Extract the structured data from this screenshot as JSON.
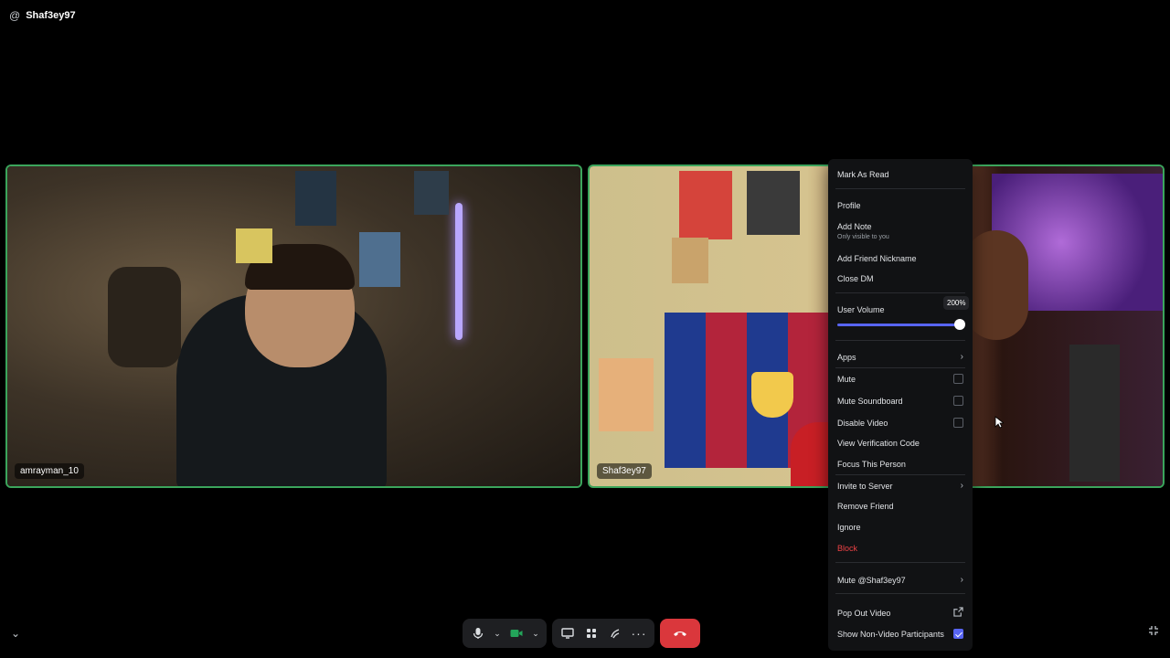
{
  "header": {
    "username": "Shaf3ey97",
    "icon": "at-icon"
  },
  "tiles": [
    {
      "name": "amrayman_10"
    },
    {
      "name": "Shaf3ey97"
    }
  ],
  "menu": {
    "mark_as_read": "Mark As Read",
    "profile": "Profile",
    "add_note": "Add Note",
    "add_note_sub": "Only visible to you",
    "add_friend_nickname": "Add Friend Nickname",
    "close_dm": "Close DM",
    "user_volume": "User Volume",
    "volume_value": "200%",
    "apps": "Apps",
    "mute": "Mute",
    "mute_soundboard": "Mute Soundboard",
    "disable_video": "Disable Video",
    "view_verification_code": "View Verification Code",
    "focus_this_person": "Focus This Person",
    "invite_to_server": "Invite to Server",
    "remove_friend": "Remove Friend",
    "ignore": "Ignore",
    "block": "Block",
    "mute_user": "Mute @Shaf3ey97",
    "pop_out_video": "Pop Out Video",
    "show_non_video": "Show Non-Video Participants",
    "colors": {
      "block": "#ed4245",
      "accent": "#5865f2"
    }
  },
  "controls": {
    "mic": "microphone-icon",
    "camera": "camera-icon",
    "screen_share": "screen-share-icon",
    "activities": "activities-icon",
    "soundboard": "soundboard-icon",
    "more": "more-icon",
    "end_call": "end-call-icon",
    "colors": {
      "end_call": "#da373c",
      "camera_on": "#23a55a"
    }
  }
}
